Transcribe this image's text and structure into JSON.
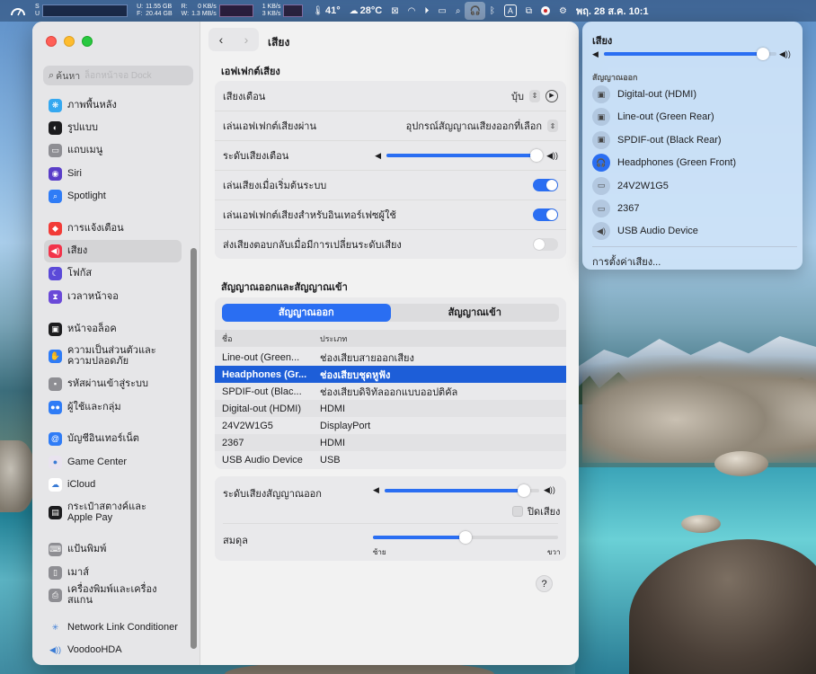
{
  "menubar": {
    "disk_label_u": "U:",
    "disk_label_f": "F:",
    "disk_u": "11.55 GB",
    "disk_f": "20.44 GB",
    "net_label_r": "R:",
    "net_label_w": "W:",
    "net_r": "0 KB/s",
    "net_w": "1.3 MB/s",
    "net2_up": "1 KB/s",
    "net2_down": "3 KB/s",
    "temp": "41°",
    "weather": "28°C",
    "input_source": "A",
    "datetime": "พฤ. 28 ส.ค.  10:1"
  },
  "sidebar": {
    "search_placeholder": "ค้นหา",
    "search_ghost": "ล็อกหน้าจอ Dock",
    "items": [
      {
        "label": "ภาพพื้นหลัง",
        "icon": "wallpaper-icon",
        "color": "#35a8f0"
      },
      {
        "label": "รูปแบบ",
        "icon": "appearance-icon",
        "color": "#1c1c1e"
      },
      {
        "label": "แถบเมนู",
        "icon": "menubar-icon",
        "color": "#8e8e93"
      },
      {
        "label": "Siri",
        "icon": "siri-icon",
        "color": "#5a3ec8"
      },
      {
        "label": "Spotlight",
        "icon": "spotlight-icon",
        "color": "#2f7cf6"
      },
      {
        "label": "การแจ้งเตือน",
        "icon": "notifications-icon",
        "color": "#f23b37"
      },
      {
        "label": "เสียง",
        "icon": "sound-icon",
        "color": "#f2334a"
      },
      {
        "label": "โฟกัส",
        "icon": "focus-icon",
        "color": "#5b4ad8"
      },
      {
        "label": "เวลาหน้าจอ",
        "icon": "screen-time-icon",
        "color": "#6a49d8"
      },
      {
        "label": "หน้าจอล็อค",
        "icon": "lock-screen-icon",
        "color": "#1c1c1e"
      },
      {
        "label": "ความเป็นส่วนตัวและ",
        "label2": "ความปลอดภัย",
        "icon": "privacy-hand-icon",
        "color": "#2f7cf6"
      },
      {
        "label": "รหัสผ่านเข้าสู่ระบบ",
        "icon": "login-password-icon",
        "color": "#8e8e93"
      },
      {
        "label": "ผู้ใช้และกลุ่ม",
        "icon": "users-groups-icon",
        "color": "#2f7cf6"
      },
      {
        "label": "บัญชีอินเทอร์เน็ต",
        "icon": "internet-accounts-icon",
        "color": "#2f7cf6"
      },
      {
        "label": "Game Center",
        "icon": "game-center-icon",
        "color": "#e9e3ef"
      },
      {
        "label": "iCloud",
        "icon": "icloud-icon",
        "color": "#ffffff"
      },
      {
        "label": "กระเป๋าสตางค์และ",
        "label2": "Apple Pay",
        "icon": "wallet-icon",
        "color": "#1c1c1e"
      },
      {
        "label": "แป้นพิมพ์",
        "icon": "keyboard-icon",
        "color": "#8e8e93"
      },
      {
        "label": "เมาส์",
        "icon": "mouse-icon",
        "color": "#8e8e93"
      },
      {
        "label": "เครื่องพิมพ์และเครื่องสแกน",
        "icon": "printer-icon",
        "color": "#8e8e93"
      },
      {
        "label": "Network Link Conditioner",
        "icon": "network-link-conditioner-icon",
        "color": "#e6e6e8"
      },
      {
        "label": "VoodooHDA",
        "icon": "voodoohda-speaker-icon",
        "color": "#e6e6e8"
      }
    ]
  },
  "toolbar": {
    "title": "เสียง"
  },
  "effects": {
    "section_title": "เอฟเฟกต์เสียง",
    "alert_sound_label": "เสียงเตือน",
    "alert_sound_value": "บุ้บ",
    "play_through_label": "เล่นเอฟเฟกต์เสียงผ่าน",
    "play_through_value": "อุปกรณ์สัญญาณเสียงออกที่เลือก",
    "alert_volume_label": "ระดับเสียงเตือน",
    "alert_volume_level": 0.97,
    "startup_label": "เล่นเสียงเมื่อเริ่มต้นระบบ",
    "startup_on": true,
    "ui_effects_label": "เล่นเอฟเฟกต์เสียงสำหรับอินเทอร์เฟซผู้ใช้",
    "ui_effects_on": true,
    "feedback_label": "ส่งเสียงตอบกลับเมื่อมีการเปลี่ยนระดับเสียง",
    "feedback_on": false
  },
  "io": {
    "section_title": "สัญญาณออกและสัญญาณเข้า",
    "tab_output": "สัญญาณออก",
    "tab_input": "สัญญาณเข้า",
    "col_name": "ชื่อ",
    "col_type": "ประเภท",
    "devices": [
      {
        "name": "Line-out (Green...",
        "type": "ช่องเสียบสายออกเสียง"
      },
      {
        "name": "Headphones (Gr...",
        "type": "ช่องเสียบชุดหูฟัง",
        "selected": true
      },
      {
        "name": "SPDIF-out (Blac...",
        "type": "ช่องเสียบดิจิทัลออกแบบออปติคัล"
      },
      {
        "name": "Digital-out (HDMI)",
        "type": "HDMI"
      },
      {
        "name": "24V2W1G5",
        "type": "DisplayPort"
      },
      {
        "name": "2367",
        "type": "HDMI"
      },
      {
        "name": "USB Audio Device",
        "type": "USB"
      }
    ],
    "output_volume_label": "ระดับเสียงสัญญาณออก",
    "output_volume_level": 0.9,
    "mute_label": "ปิดเสียง",
    "balance_label": "สมดุล",
    "balance_level": 0.5,
    "balance_left": "ซ้าย",
    "balance_right": "ขวา",
    "help": "?"
  },
  "popover": {
    "title": "เสียง",
    "volume_level": 0.92,
    "output_header": "สัญญาณออก",
    "devices": [
      {
        "name": "Digital-out (HDMI)",
        "icon": "speaker-box-icon"
      },
      {
        "name": "Line-out (Green Rear)",
        "icon": "speaker-box-icon"
      },
      {
        "name": "SPDIF-out (Black Rear)",
        "icon": "speaker-box-icon"
      },
      {
        "name": "Headphones (Green Front)",
        "icon": "headphones-icon",
        "active": true
      },
      {
        "name": "24V2W1G5",
        "icon": "display-icon"
      },
      {
        "name": "2367",
        "icon": "display-icon"
      },
      {
        "name": "USB Audio Device",
        "icon": "speaker-volume-icon"
      }
    ],
    "settings_label": "การตั้งค่าเสียง..."
  },
  "colors": {
    "accent": "#2a6ef2",
    "selection": "#1d5ed8"
  }
}
